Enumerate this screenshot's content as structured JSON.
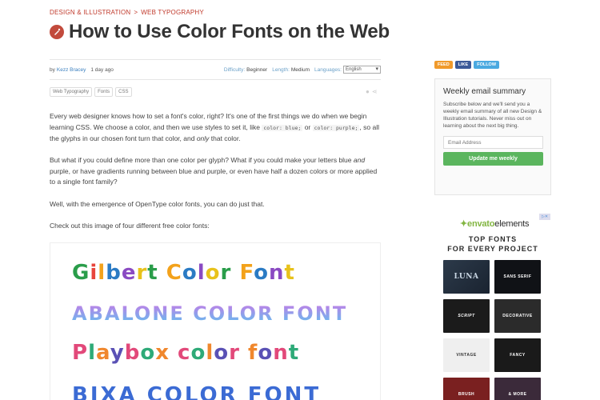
{
  "breadcrumb": {
    "category": "DESIGN & ILLUSTRATION",
    "separator": ">",
    "subcategory": "WEB TYPOGRAPHY"
  },
  "article": {
    "title": "How to Use Color Fonts on the Web",
    "title_icon": "pen-nib-icon"
  },
  "meta": {
    "by_label": "by",
    "author": "Kezz Bracey",
    "ago": "1 day ago",
    "difficulty_label": "Difficulty:",
    "difficulty": "Beginner",
    "length_label": "Length:",
    "length": "Medium",
    "languages_label": "Languages:",
    "language_selected": "English"
  },
  "tags": [
    "Web Typography",
    "Fonts",
    "CSS"
  ],
  "share_icons": [
    "comment-icon",
    "share-icon"
  ],
  "body": {
    "p1_a": "Every web designer knows how to set a font's color, right? It's one of the first things we do when we begin learning CSS. We choose a color, and then we use styles to set it, like ",
    "p1_code1": "color: blue;",
    "p1_b": " or ",
    "p1_code2": "color: purple;",
    "p1_c": ", so all the glyphs in our chosen font turn that color, and ",
    "p1_em": "only",
    "p1_d": " that color.",
    "p2_a": "But what if you could define more than one color per glyph? What if you could make your letters blue ",
    "p2_em": "and",
    "p2_b": " purple, or have gradients running between blue and purple, or even have half a dozen colors or more applied to a single font family?",
    "p3": "Well, with the emergence of OpenType color fonts, you can do just that.",
    "p4": "Check out this image of four different free color fonts:"
  },
  "figure": {
    "line1": "Gilbert Color Font",
    "line2": "ABALONE COLOR FONT",
    "line3": "Playbox color font",
    "line4": "BIXA COLOR FONT"
  },
  "sidebar": {
    "social": {
      "feed": "FEED",
      "like": "LIKE",
      "follow": "FOLLOW"
    },
    "newsletter": {
      "title": "Weekly email summary",
      "text": "Subscribe below and we'll send you a weekly email summary of all new Design & Illustration tutorials. Never miss out on learning about the next big thing.",
      "email_placeholder": "Email Address",
      "button": "Update me weekly"
    },
    "ad": {
      "adchoices": "▷✕",
      "logo_brand": "envato",
      "logo_product": "elements",
      "headline1": "TOP FONTS",
      "headline2": "FOR EVERY PROJECT",
      "tiles": [
        "LUNA",
        "SANS SERIF",
        "SCRIPT",
        "DECORATIVE",
        "VINTAGE",
        "FANCY",
        "BRUSH",
        "& MORE"
      ]
    }
  },
  "colors": {
    "accent_red": "#c0392b",
    "link_blue": "#3a7fbf",
    "button_green": "#5bb55e",
    "envato_green": "#82b541"
  }
}
